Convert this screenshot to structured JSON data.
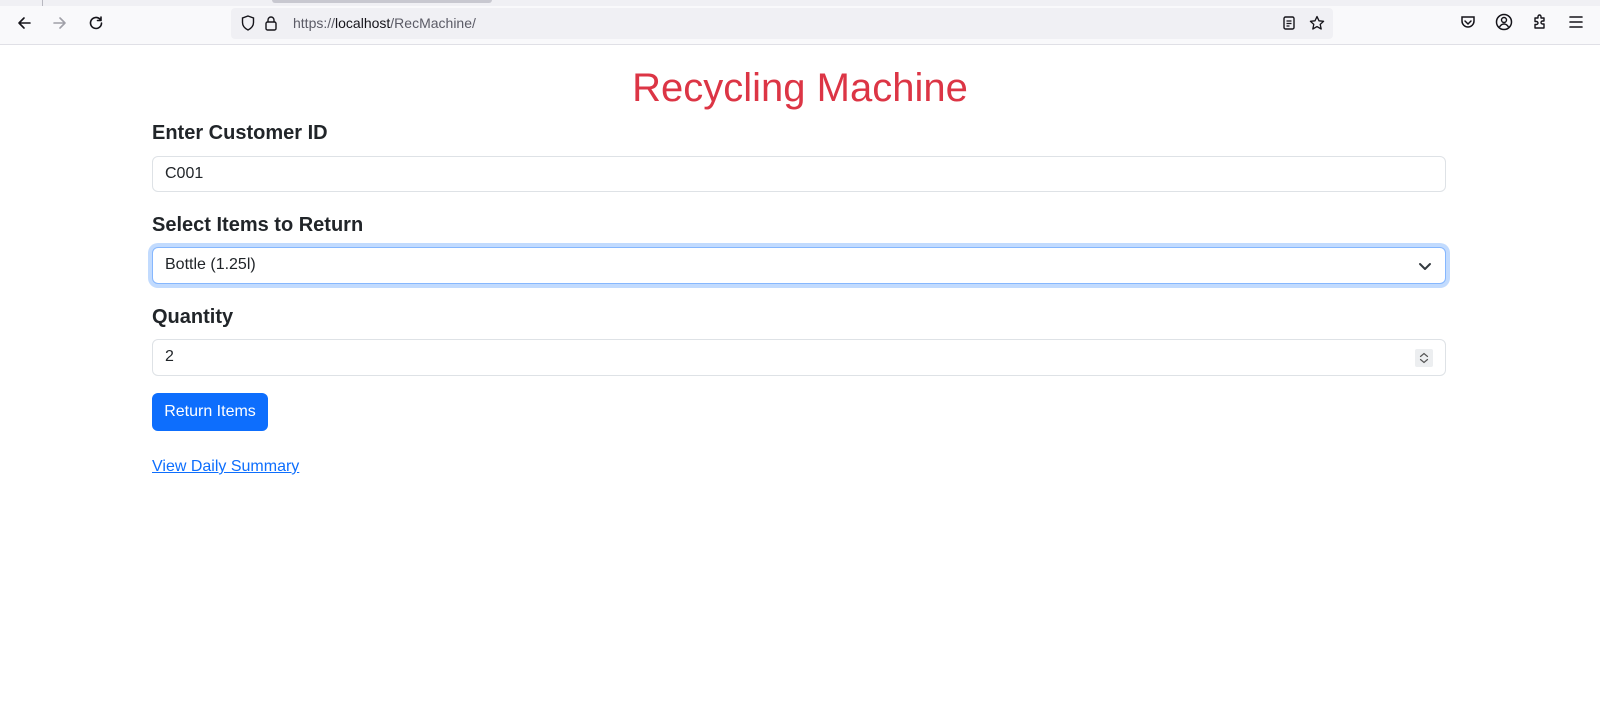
{
  "browser": {
    "url_scheme": "https://",
    "url_host": "localhost",
    "url_path": "/RecMachine/",
    "icons": [
      "back-icon",
      "forward-icon",
      "reload-icon",
      "shield-icon",
      "lock-icon",
      "reader-view-icon",
      "bookmark-star-icon",
      "pocket-icon",
      "account-icon",
      "extensions-icon",
      "menu-icon"
    ]
  },
  "page": {
    "title": "Recycling Machine",
    "title_color": "#dc3545",
    "customer_label": "Enter Customer ID",
    "customer_value": "C001",
    "items_label": "Select Items to Return",
    "items_selected": "Bottle (1.25l)",
    "quantity_label": "Quantity",
    "quantity_value": "2",
    "return_button": "Return Items",
    "summary_link": "View Daily Summary",
    "accent_color": "#0d6efd"
  }
}
